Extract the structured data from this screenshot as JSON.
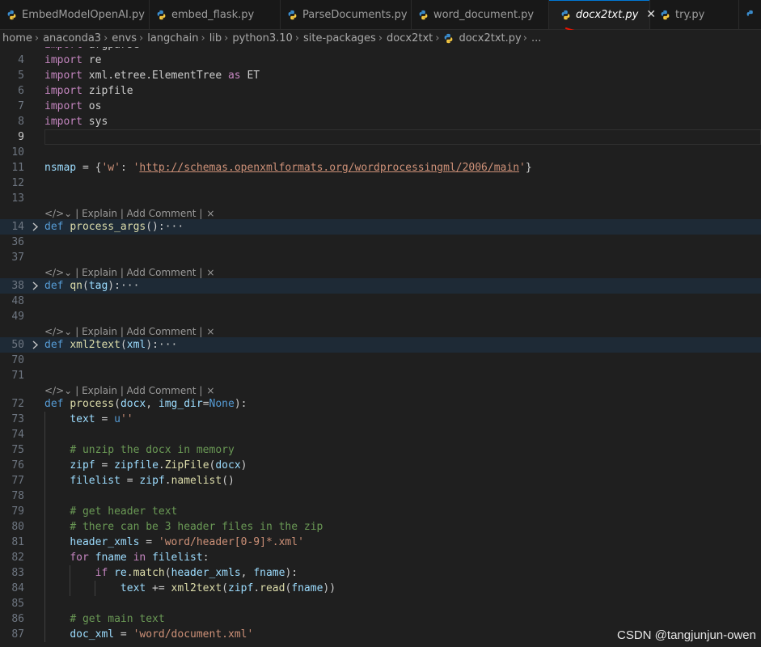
{
  "tabs": [
    {
      "label": "EmbedModelOpenAI.py",
      "active": false
    },
    {
      "label": "embed_flask.py",
      "active": false
    },
    {
      "label": "ParseDocuments.py",
      "active": false
    },
    {
      "label": "word_document.py",
      "active": false
    },
    {
      "label": "docx2txt.py",
      "active": true
    },
    {
      "label": "try.py",
      "active": false
    }
  ],
  "breadcrumb": {
    "items": [
      "home",
      "anaconda3",
      "envs",
      "langchain",
      "lib",
      "python3.10",
      "site-packages",
      "docx2txt"
    ],
    "file": "docx2txt.py",
    "ellipsis": "..."
  },
  "codelens": {
    "text": "| Explain | Add Comment |",
    "close": "×"
  },
  "editor": {
    "lines": [
      {
        "n": "",
        "code": "import argparse"
      },
      {
        "n": "4",
        "code": "import re"
      },
      {
        "n": "5",
        "code": "import xml.etree.ElementTree as ET"
      },
      {
        "n": "6",
        "code": "import zipfile"
      },
      {
        "n": "7",
        "code": "import os"
      },
      {
        "n": "8",
        "code": "import sys"
      },
      {
        "n": "9",
        "code": ""
      },
      {
        "n": "10",
        "code": ""
      },
      {
        "n": "11",
        "code": "nsmap = {'w': 'http://schemas.openxmlformats.org/wordprocessingml/2006/main'}"
      },
      {
        "n": "12",
        "code": ""
      },
      {
        "n": "13",
        "code": ""
      },
      {
        "n": "14",
        "code": "def process_args():···"
      },
      {
        "n": "36",
        "code": ""
      },
      {
        "n": "37",
        "code": ""
      },
      {
        "n": "38",
        "code": "def qn(tag):···"
      },
      {
        "n": "48",
        "code": ""
      },
      {
        "n": "49",
        "code": ""
      },
      {
        "n": "50",
        "code": "def xml2text(xml):···"
      },
      {
        "n": "70",
        "code": ""
      },
      {
        "n": "71",
        "code": ""
      },
      {
        "n": "72",
        "code": "def process(docx, img_dir=None):"
      },
      {
        "n": "73",
        "code": "    text = u''"
      },
      {
        "n": "74",
        "code": ""
      },
      {
        "n": "75",
        "code": "    # unzip the docx in memory"
      },
      {
        "n": "76",
        "code": "    zipf = zipfile.ZipFile(docx)"
      },
      {
        "n": "77",
        "code": "    filelist = zipf.namelist()"
      },
      {
        "n": "78",
        "code": ""
      },
      {
        "n": "79",
        "code": "    # get header text"
      },
      {
        "n": "80",
        "code": "    # there can be 3 header files in the zip"
      },
      {
        "n": "81",
        "code": "    header_xmls = 'word/header[0-9]*.xml'"
      },
      {
        "n": "82",
        "code": "    for fname in filelist:"
      },
      {
        "n": "83",
        "code": "        if re.match(header_xmls, fname):"
      },
      {
        "n": "84",
        "code": "            text += xml2text(zipf.read(fname))"
      },
      {
        "n": "85",
        "code": ""
      },
      {
        "n": "86",
        "code": "    # get main text"
      },
      {
        "n": "87",
        "code": "    doc_xml = 'word/document.xml'"
      }
    ]
  },
  "watermark": "CSDN @tangjunjun-owen",
  "colors": {
    "accent": "#0078d4",
    "underline_mark": "#e51400"
  }
}
